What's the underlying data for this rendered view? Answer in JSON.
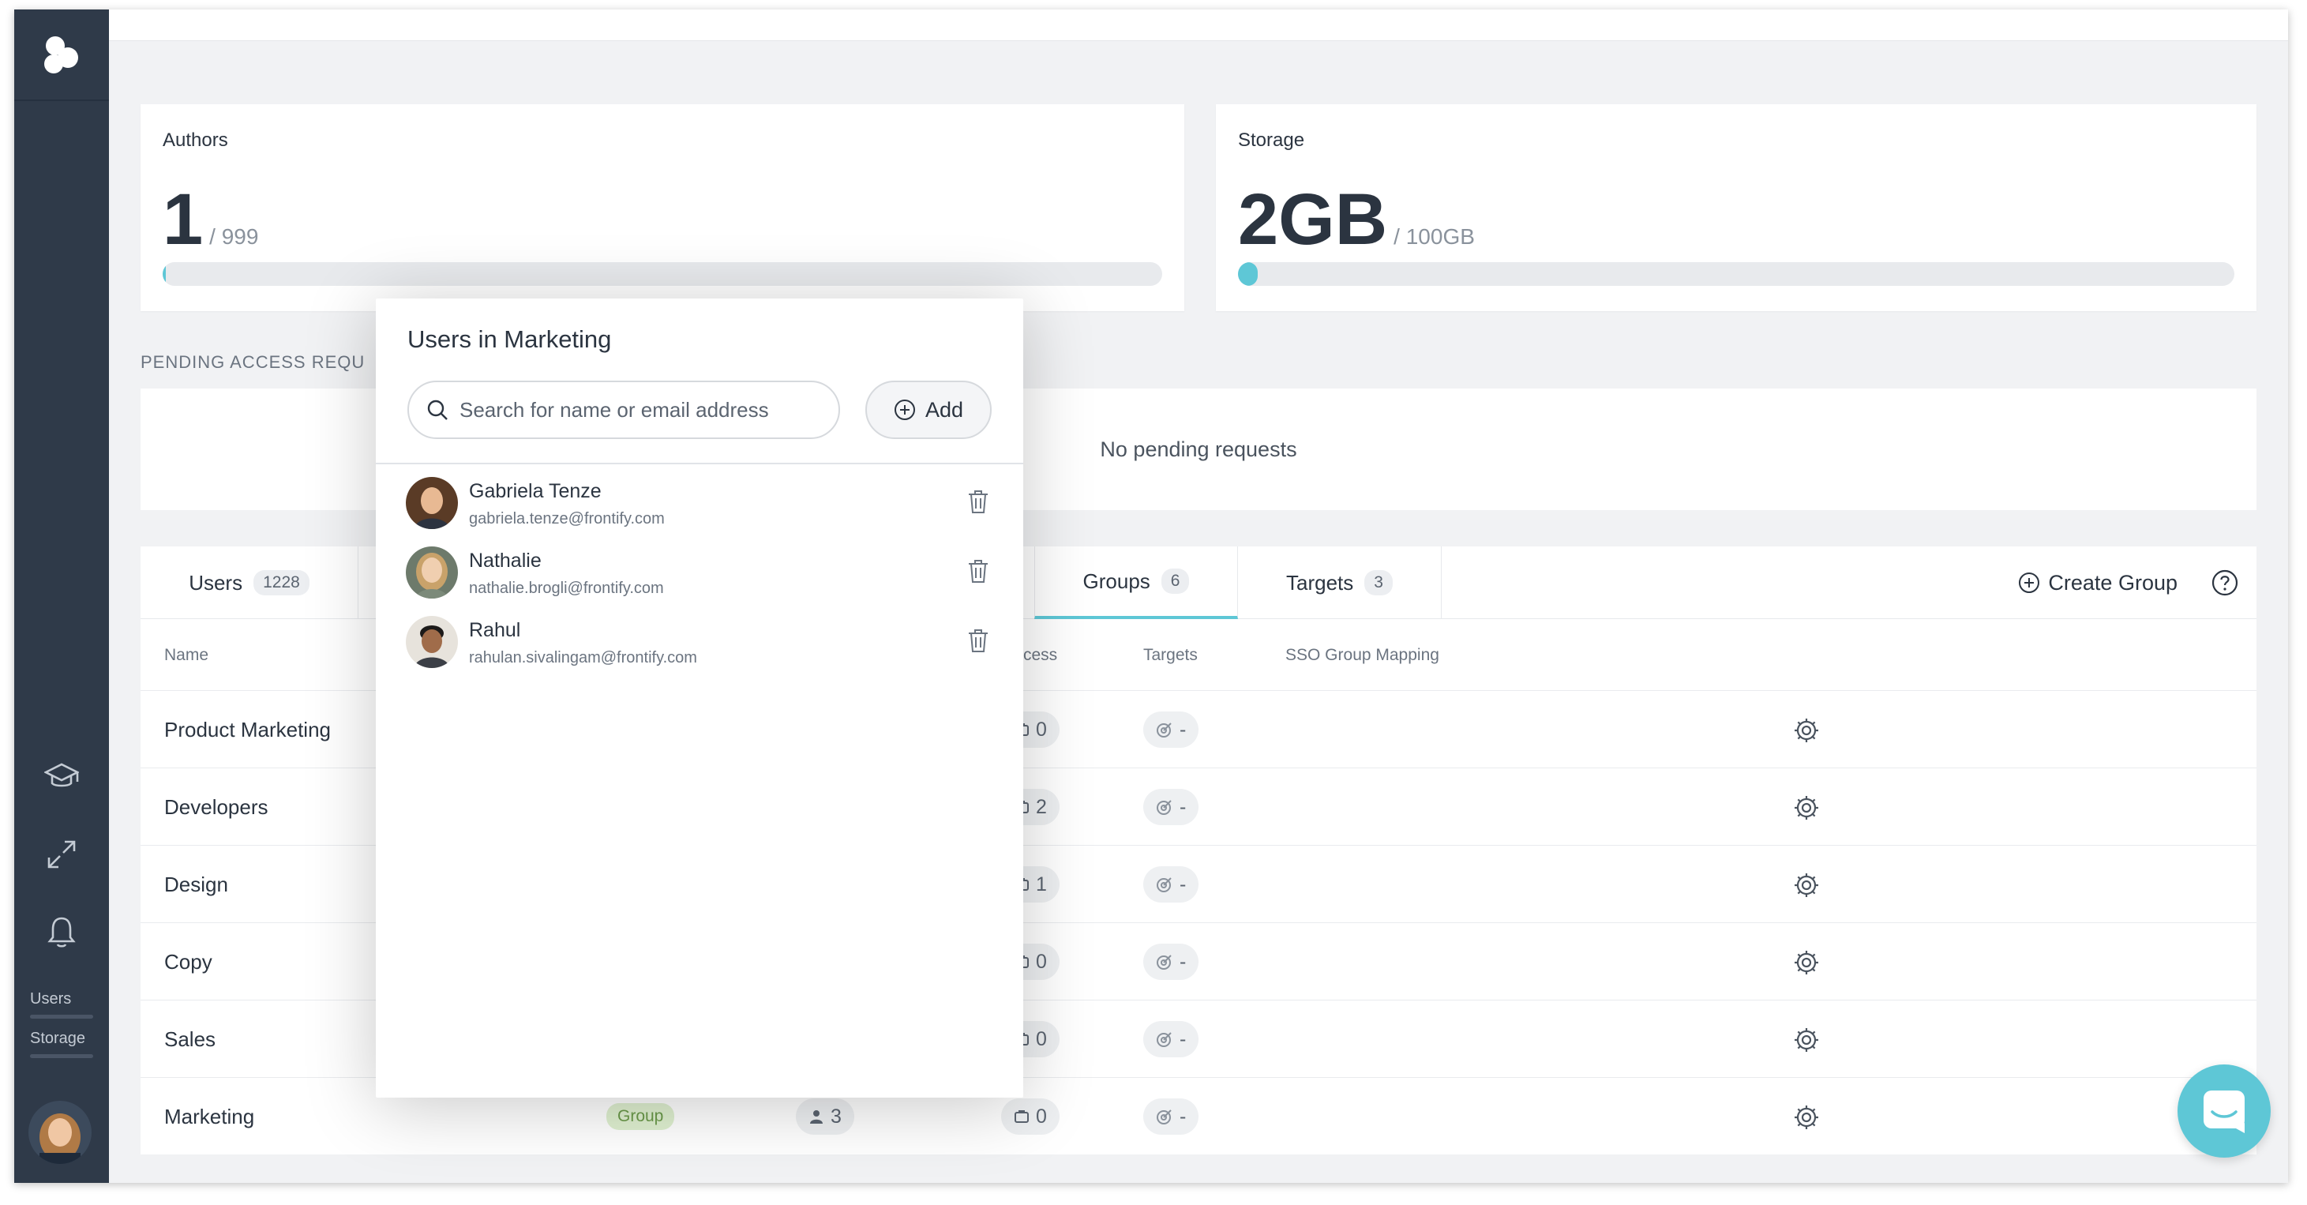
{
  "authors": {
    "title": "Authors",
    "value": "1",
    "max": "/ 999",
    "fraction": 0.001
  },
  "storage": {
    "title": "Storage",
    "value": "2GB",
    "max": "/ 100GB",
    "fraction": 0.02
  },
  "pending": {
    "label": "PENDING ACCESS REQU",
    "empty_text": "No pending requests"
  },
  "tabs": [
    {
      "label": "Users",
      "count": "1228"
    },
    {
      "label": "Groups",
      "count": "6"
    },
    {
      "label": "Targets",
      "count": "3"
    }
  ],
  "toolbar": {
    "create_group": "Create Group"
  },
  "columns": {
    "name": "Name",
    "access": "cess",
    "targets": "Targets",
    "sso": "SSO Group Mapping"
  },
  "rows": [
    {
      "name": "Product Marketing",
      "access": "0",
      "targets": "-"
    },
    {
      "name": "Developers",
      "access": "2",
      "targets": "-"
    },
    {
      "name": "Design",
      "access": "1",
      "targets": "-"
    },
    {
      "name": "Copy",
      "access": "0",
      "targets": "-"
    },
    {
      "name": "Sales",
      "access": "0",
      "targets": "-"
    },
    {
      "name": "Marketing",
      "badge": "Group",
      "members": "3",
      "access": "0",
      "targets": "-"
    }
  ],
  "sidebar": {
    "users_label": "Users",
    "storage_label": "Storage"
  },
  "popup": {
    "title": "Users in Marketing",
    "search_placeholder": "Search for name or email address",
    "add_label": "Add",
    "users": [
      {
        "name": "Gabriela Tenze",
        "email": "gabriela.tenze@frontify.com"
      },
      {
        "name": "Nathalie",
        "email": "nathalie.brogli@frontify.com"
      },
      {
        "name": "Rahul",
        "email": "rahulan.sivalingam@frontify.com"
      }
    ]
  },
  "colors": {
    "accent": "#5ec7d6",
    "sidebar": "#2f3a49",
    "group_badge_bg": "#dff0d0"
  }
}
